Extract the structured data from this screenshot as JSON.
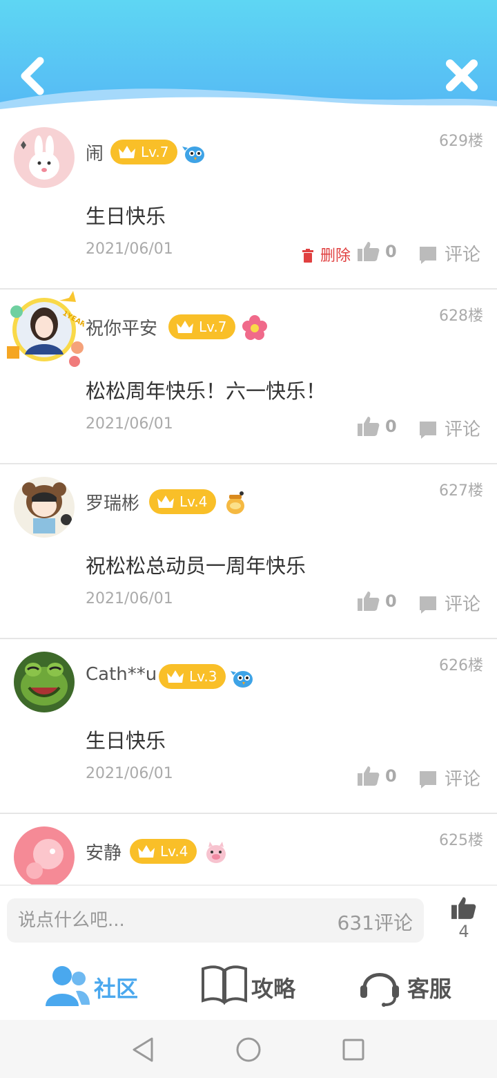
{
  "header": {
    "back_icon": "chevron-left-icon",
    "close_icon": "close-icon"
  },
  "comments": [
    {
      "username": "闹",
      "level": "Lv.7",
      "floor": "629楼",
      "content": "生日快乐",
      "date": "2021/06/01",
      "delete_label": "删除",
      "likes": "0",
      "comment_label": "评论",
      "badge": "bird-icon"
    },
    {
      "username": "祝你平安",
      "level": "Lv.7",
      "floor": "628楼",
      "content": "松松周年快乐！六一快乐！",
      "date": "2021/06/01",
      "likes": "0",
      "comment_label": "评论",
      "badge": "flower-icon",
      "avatar_frame_text": "1YEAR"
    },
    {
      "username": "罗瑞彬",
      "level": "Lv.4",
      "floor": "627楼",
      "content": "祝松松总动员一周年快乐",
      "date": "2021/06/01",
      "likes": "0",
      "comment_label": "评论",
      "badge": "honey-jar-icon"
    },
    {
      "username": "Cath**u",
      "level": "Lv.3",
      "floor": "626楼",
      "content": "生日快乐",
      "date": "2021/06/01",
      "likes": "0",
      "comment_label": "评论",
      "badge": "bird-icon"
    },
    {
      "username": "安静",
      "level": "Lv.4",
      "floor": "625楼",
      "badge": "pig-icon"
    }
  ],
  "input_bar": {
    "placeholder": "说点什么吧...",
    "comment_count": "631评论",
    "total_likes": "4"
  },
  "bottom_nav": [
    {
      "label": "社区",
      "icon": "community-icon",
      "active": true,
      "color": "#4aa8ee"
    },
    {
      "label": "攻略",
      "icon": "book-icon",
      "active": false,
      "color": "#555555"
    },
    {
      "label": "客服",
      "icon": "headset-icon",
      "active": false,
      "color": "#555555"
    }
  ],
  "system_bar": {
    "back": "nav-back-icon",
    "home": "nav-home-icon",
    "recents": "nav-recents-icon"
  }
}
